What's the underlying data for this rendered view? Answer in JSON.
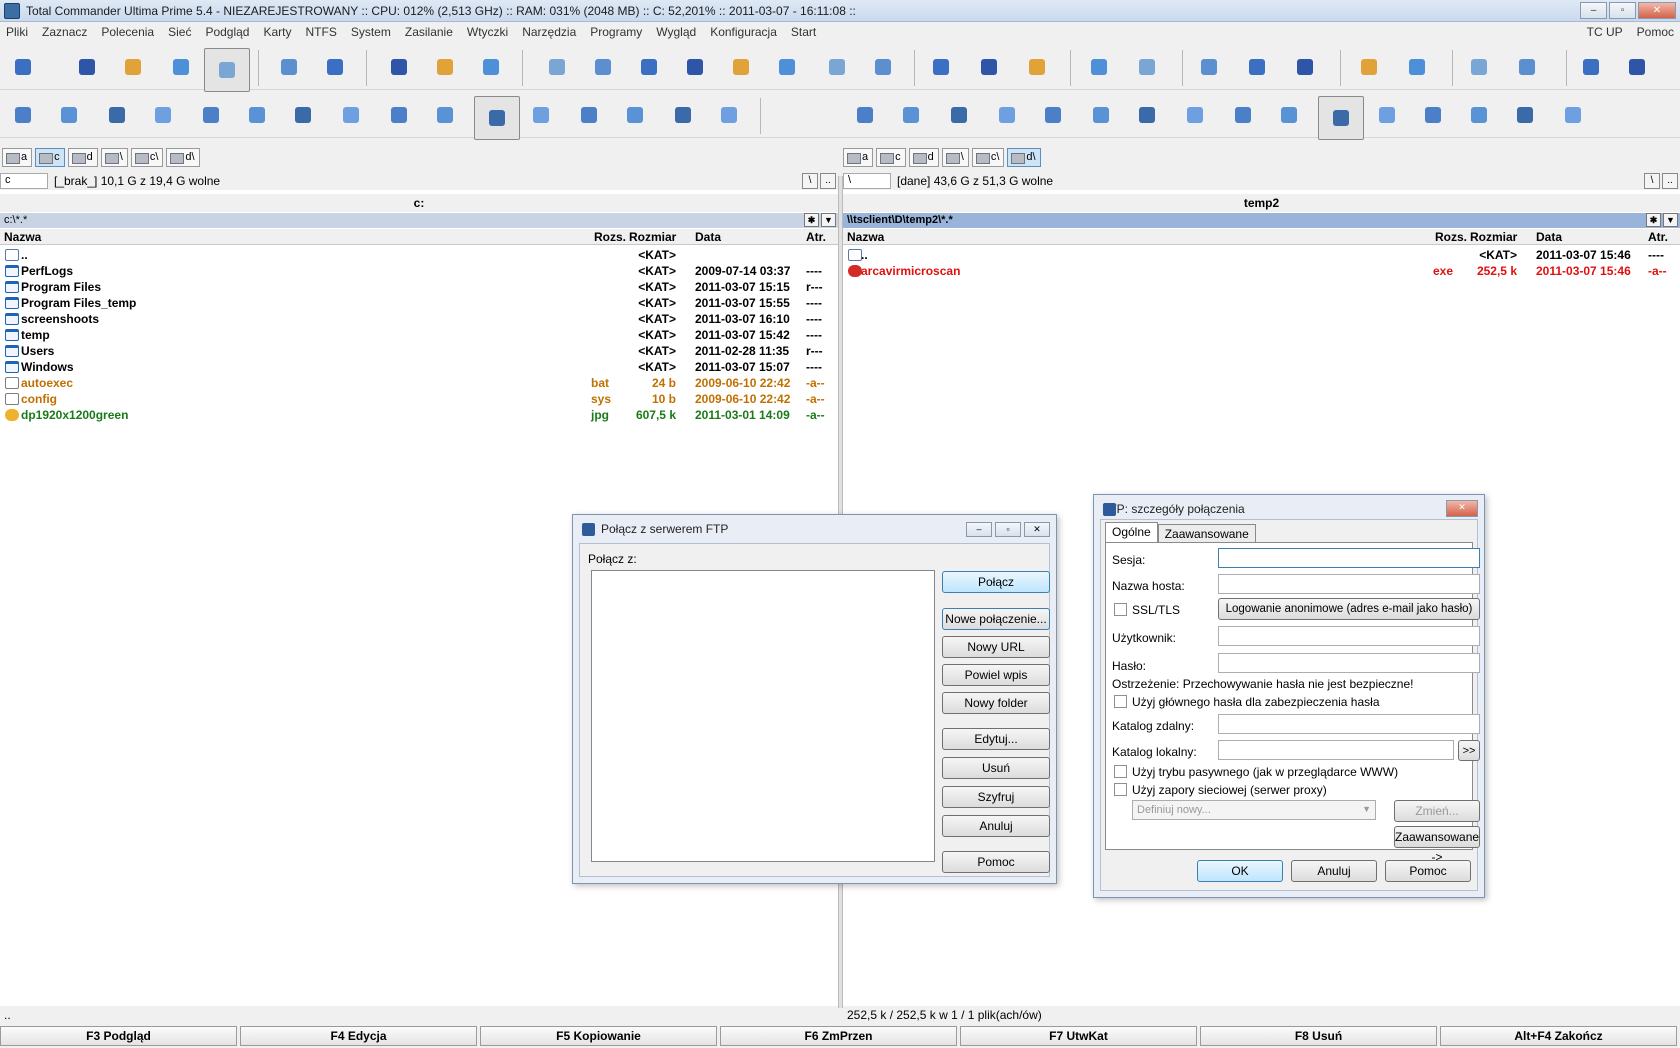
{
  "window": {
    "title": "Total Commander Ultima Prime 5.4 - NIEZAREJESTROWANY :: CPU: 012% (2,513 GHz) :: RAM: 031% (2048 MB) :: C: 52,201% :: 2011-03-07 - 16:11:08 ::"
  },
  "menu": {
    "items": [
      "Pliki",
      "Zaznacz",
      "Polecenia",
      "Sieć",
      "Podgląd",
      "Karty",
      "NTFS",
      "System",
      "Zasilanie",
      "Wtyczki",
      "Narzędzia",
      "Programy",
      "Wygląd",
      "Konfiguracja",
      "Start"
    ],
    "right": [
      "TC UP",
      "Pomoc"
    ]
  },
  "left_panel": {
    "drives": [
      "a",
      "c",
      "d",
      "\\",
      "c\\",
      "d\\"
    ],
    "drive_select": "c",
    "free": "[_brak_]  10,1 G z 19,4 G wolne",
    "title": "c:",
    "path": "c:\\*.*",
    "headers": {
      "name": "Nazwa",
      "ext": "Rozs.",
      "size": "Rozmiar",
      "date": "Data",
      "attr": "Atr."
    },
    "rows": [
      {
        "name": "..",
        "ext": "",
        "size": "<KAT>",
        "date": "",
        "attr": "",
        "icon": "up",
        "color": "#000000"
      },
      {
        "name": "PerfLogs",
        "ext": "",
        "size": "<KAT>",
        "date": "2009-07-14 03:37",
        "attr": "----",
        "icon": "folder",
        "color": "#000000"
      },
      {
        "name": "Program Files",
        "ext": "",
        "size": "<KAT>",
        "date": "2011-03-07 15:15",
        "attr": "r---",
        "icon": "folder",
        "color": "#000000"
      },
      {
        "name": "Program Files_temp",
        "ext": "",
        "size": "<KAT>",
        "date": "2011-03-07 15:55",
        "attr": "----",
        "icon": "folder",
        "color": "#000000"
      },
      {
        "name": "screenshoots",
        "ext": "",
        "size": "<KAT>",
        "date": "2011-03-07 16:10",
        "attr": "----",
        "icon": "folder",
        "color": "#000000"
      },
      {
        "name": "temp",
        "ext": "",
        "size": "<KAT>",
        "date": "2011-03-07 15:42",
        "attr": "----",
        "icon": "folder",
        "color": "#000000"
      },
      {
        "name": "Users",
        "ext": "",
        "size": "<KAT>",
        "date": "2011-02-28 11:35",
        "attr": "r---",
        "icon": "folder",
        "color": "#000000"
      },
      {
        "name": "Windows",
        "ext": "",
        "size": "<KAT>",
        "date": "2011-03-07 15:07",
        "attr": "----",
        "icon": "folder",
        "color": "#000000"
      },
      {
        "name": "autoexec",
        "ext": "bat",
        "size": "24 b",
        "date": "2009-06-10 22:42",
        "attr": "-a--",
        "icon": "file",
        "color": "#c07000"
      },
      {
        "name": "config",
        "ext": "sys",
        "size": "10 b",
        "date": "2009-06-10 22:42",
        "attr": "-a--",
        "icon": "file",
        "color": "#c07000"
      },
      {
        "name": "dp1920x1200green",
        "ext": "jpg",
        "size": "607,5 k",
        "date": "2011-03-01 14:09",
        "attr": "-a--",
        "icon": "jpg",
        "color": "#1a7a1a"
      }
    ],
    "status": ".."
  },
  "right_panel": {
    "drives": [
      "a",
      "c",
      "d",
      "\\",
      "c\\",
      "d\\"
    ],
    "drive_select": "\\",
    "free": "[dane]  43,6 G z 51,3 G wolne",
    "title": "temp2",
    "path": "\\\\tsclient\\D\\temp2\\*.*",
    "headers": {
      "name": "Nazwa",
      "ext": "Rozs.",
      "size": "Rozmiar",
      "date": "Data",
      "attr": "Atr."
    },
    "rows": [
      {
        "name": "..",
        "ext": "",
        "size": "<KAT>",
        "date": "2011-03-07 15:46",
        "attr": "----",
        "icon": "up",
        "color": "#000000"
      },
      {
        "name": "arcavirmicroscan",
        "ext": "exe",
        "size": "252,5 k",
        "date": "2011-03-07 15:46",
        "attr": "-a--",
        "icon": "exe",
        "color": "#e01010"
      }
    ],
    "status": "252,5 k / 252,5 k w 1 / 1 plik(ach/ów)"
  },
  "fkeys": [
    "F3 Podgląd",
    "F4 Edycja",
    "F5 Kopiowanie",
    "F6 ZmPrzen",
    "F7 UtwKat",
    "F8 Usuń",
    "Alt+F4 Zakończ"
  ],
  "ftp_connect": {
    "title": "Połącz z serwerem FTP",
    "label": "Połącz z:",
    "buttons": [
      "Połącz",
      "Nowe połączenie...",
      "Nowy URL",
      "Powiel wpis",
      "Nowy folder",
      "Edytuj...",
      "Usuń",
      "Szyfruj",
      "Anuluj",
      "Pomoc"
    ]
  },
  "ftp_details": {
    "title": "FTP: szczegóły połączenia",
    "tabs": [
      "Ogólne",
      "Zaawansowane"
    ],
    "session_label": "Sesja:",
    "host_label": "Nazwa hosta:",
    "ssl_label": "SSL/TLS",
    "anon_button": "Logowanie anonimowe (adres e-mail jako hasło)",
    "user_label": "Użytkownik:",
    "pass_label": "Hasło:",
    "warning": "Ostrzeżenie: Przechowywanie hasła nie jest bezpieczne!",
    "master_pass": "Użyj głównego hasła dla zabezpieczenia hasła",
    "remote_label": "Katalog zdalny:",
    "local_label": "Katalog lokalny:",
    "browse": ">>",
    "passive": "Użyj trybu pasywnego (jak w przeglądarce WWW)",
    "firewall": "Użyj zapory sieciowej (serwer proxy)",
    "proxy_select": "Definiuj nowy...",
    "change_button": "Zmień...",
    "advanced_button": "Zaawansowane ->",
    "ok": "OK",
    "cancel": "Anuluj",
    "help": "Pomoc"
  },
  "colors": {
    "accent": "#1f63b4",
    "panel_path_active": "#99b4d8",
    "exe": "#e01010",
    "sysfile": "#c07000",
    "image": "#1a7a1a"
  }
}
